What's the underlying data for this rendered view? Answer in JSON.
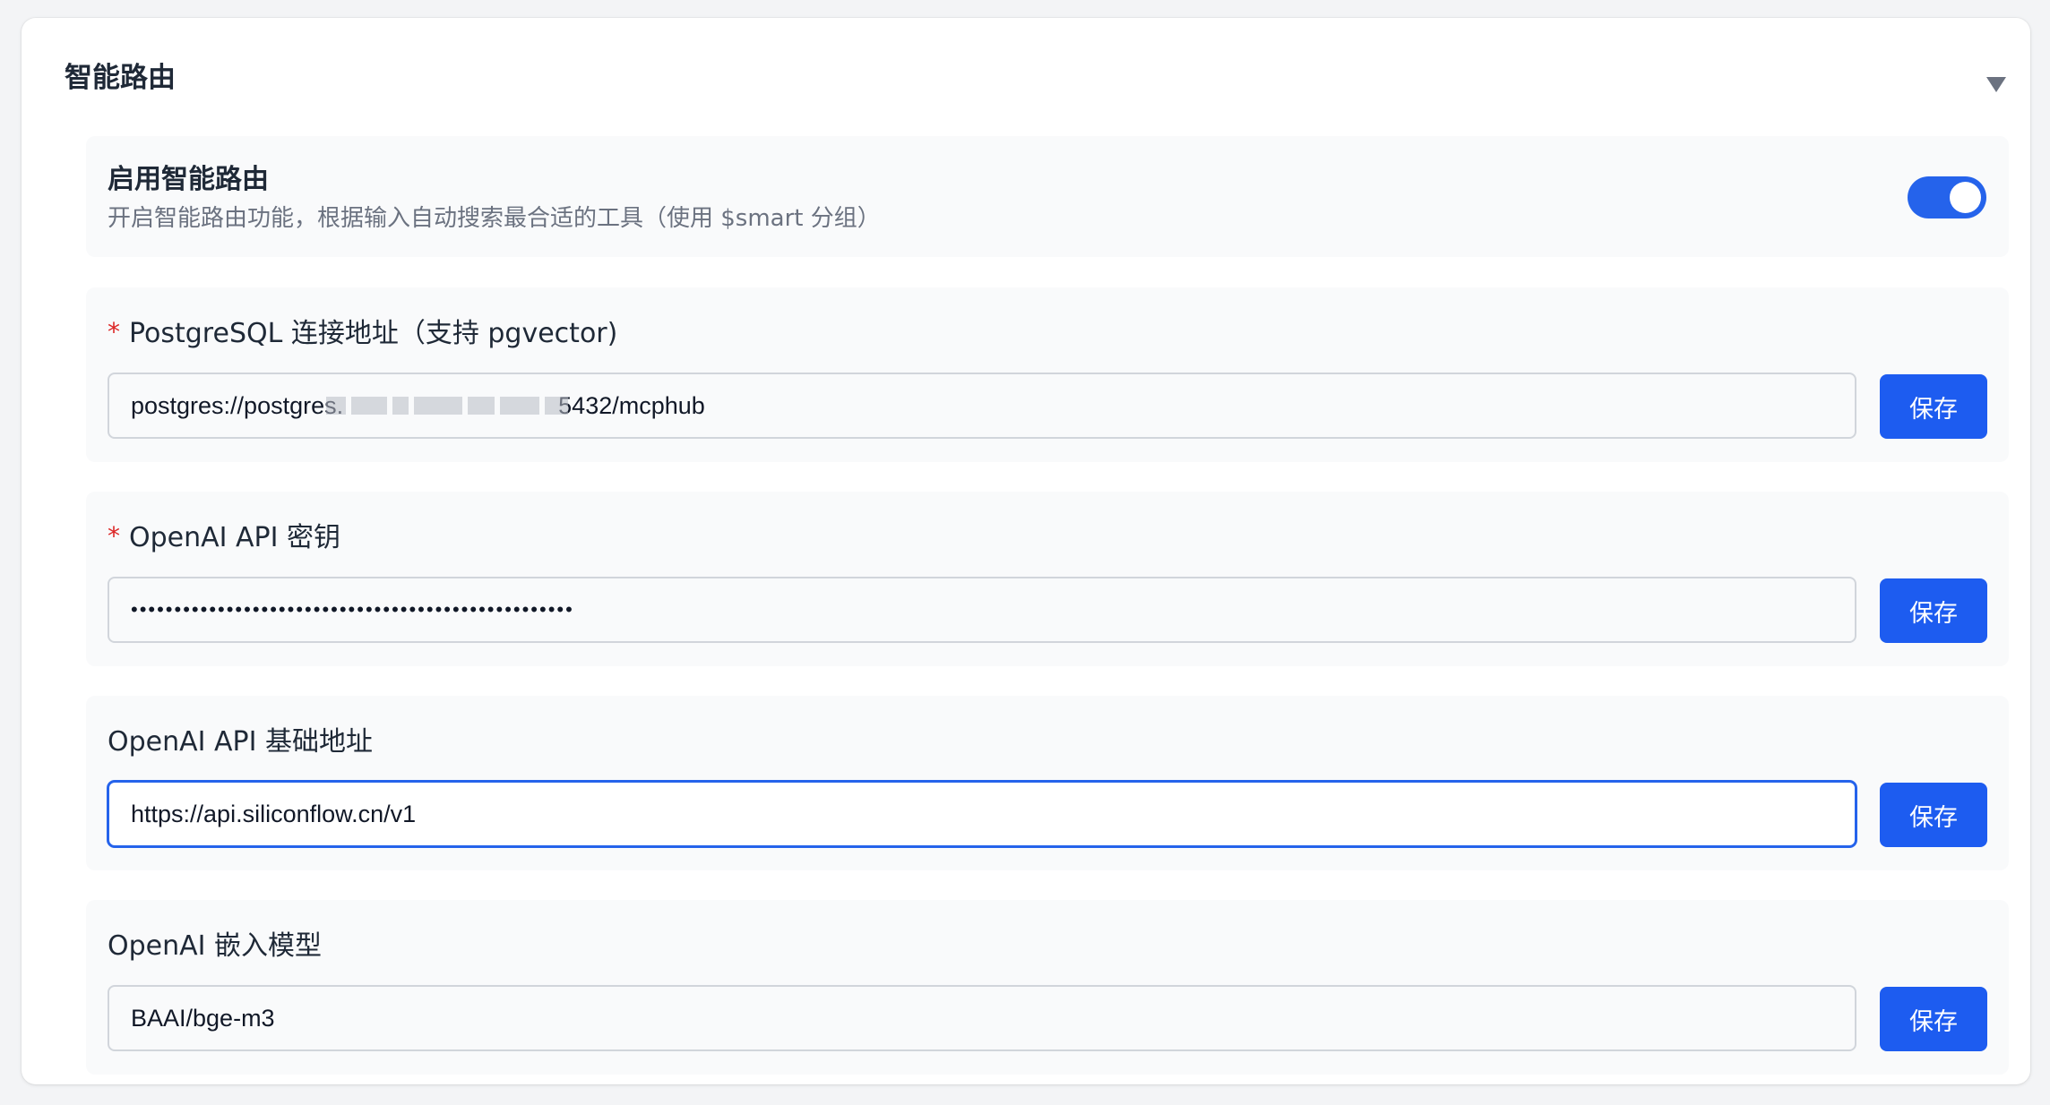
{
  "panel": {
    "title": "智能路由",
    "collapse_icon": "triangle-down-icon"
  },
  "smart_routing": {
    "title": "启用智能路由",
    "description": "开启智能路由功能，根据输入自动搜索最合适的工具（使用 $smart 分组）",
    "enabled": true,
    "accent_color": "#2563eb"
  },
  "fields": [
    {
      "required": true,
      "required_mark": "*",
      "label": "PostgreSQL 连接地址（支持 pgvector)",
      "value": "postgres://postgres.                                5432/mcphub",
      "redacted": true,
      "save_label": "保存"
    },
    {
      "required": true,
      "required_mark": "*",
      "label": "OpenAI API 密钥",
      "value": "•••••••••••••••••••••••••••••••••••••••••••••••••••",
      "save_label": "保存"
    },
    {
      "required": false,
      "label": "OpenAI API 基础地址",
      "value": "https://api.siliconflow.cn/v1",
      "focused": true,
      "save_label": "保存"
    },
    {
      "required": false,
      "label": "OpenAI 嵌入模型",
      "value": "BAAI/bge-m3",
      "save_label": "保存"
    }
  ],
  "colors": {
    "primary_button": "#1d5cf0",
    "required_mark": "#dc2626",
    "section_bg": "#f9fafb"
  }
}
